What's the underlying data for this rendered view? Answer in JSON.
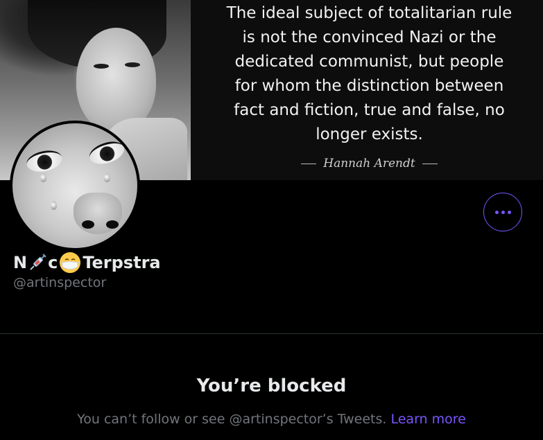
{
  "banner": {
    "quote": "The ideal subject of totalitarian rule\nis not the convinced Nazi or the\ndedicated communist, but people\nfor whom the distinction between\nfact and fiction, true and false, no\nlonger exists.",
    "author": "Hannah Arendt"
  },
  "profile": {
    "name_part1": "N",
    "name_part2": "c",
    "name_part3": " Terpstra",
    "name_icons": [
      "syringe-icon",
      "face-with-mask-icon"
    ],
    "handle": "@artinspector"
  },
  "actions": {
    "more_icon": "more-dots-icon"
  },
  "blocked": {
    "title": "You’re blocked",
    "message": "You can’t follow or see @artinspector’s Tweets.",
    "link": "Learn more"
  },
  "colors": {
    "background": "#000000",
    "accent": "#7856ff",
    "text_primary": "#e7e9ea",
    "text_secondary": "#71767b",
    "divider": "#2f3336"
  }
}
